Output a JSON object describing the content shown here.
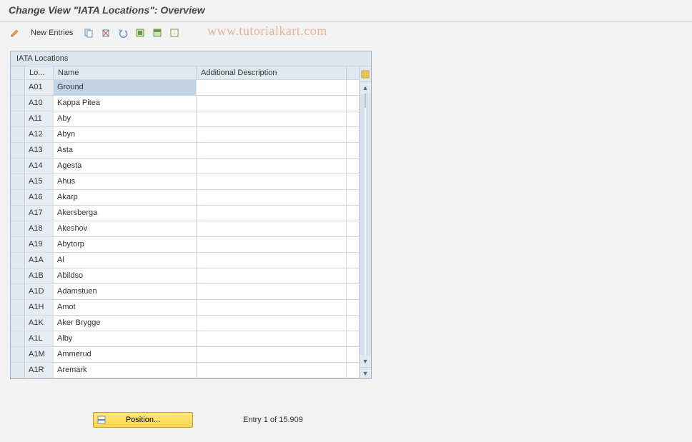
{
  "header": {
    "title": "Change View \"IATA Locations\": Overview"
  },
  "toolbar": {
    "new_entries": "New Entries"
  },
  "watermark": "www.tutorialkart.com",
  "table": {
    "title": "IATA Locations",
    "columns": {
      "lo": "Lo...",
      "name": "Name",
      "desc": "Additional Description"
    },
    "rows": [
      {
        "lo": "A01",
        "name": "Ground",
        "desc": ""
      },
      {
        "lo": "A10",
        "name": "Kappa Pitea",
        "desc": ""
      },
      {
        "lo": "A11",
        "name": "Aby",
        "desc": ""
      },
      {
        "lo": "A12",
        "name": "Abyn",
        "desc": ""
      },
      {
        "lo": "A13",
        "name": "Asta",
        "desc": ""
      },
      {
        "lo": "A14",
        "name": "Agesta",
        "desc": ""
      },
      {
        "lo": "A15",
        "name": "Ahus",
        "desc": ""
      },
      {
        "lo": "A16",
        "name": "Akarp",
        "desc": ""
      },
      {
        "lo": "A17",
        "name": "Akersberga",
        "desc": ""
      },
      {
        "lo": "A18",
        "name": "Akeshov",
        "desc": ""
      },
      {
        "lo": "A19",
        "name": "Abytorp",
        "desc": ""
      },
      {
        "lo": "A1A",
        "name": "Al",
        "desc": ""
      },
      {
        "lo": "A1B",
        "name": "Abildso",
        "desc": ""
      },
      {
        "lo": "A1D",
        "name": "Adamstuen",
        "desc": ""
      },
      {
        "lo": "A1H",
        "name": "Amot",
        "desc": ""
      },
      {
        "lo": "A1K",
        "name": "Aker Brygge",
        "desc": ""
      },
      {
        "lo": "A1L",
        "name": "Alby",
        "desc": ""
      },
      {
        "lo": "A1M",
        "name": "Ammerud",
        "desc": ""
      },
      {
        "lo": "A1R",
        "name": "Aremark",
        "desc": ""
      }
    ]
  },
  "footer": {
    "position_label": "Position...",
    "entry_status": "Entry 1 of 15.909"
  }
}
